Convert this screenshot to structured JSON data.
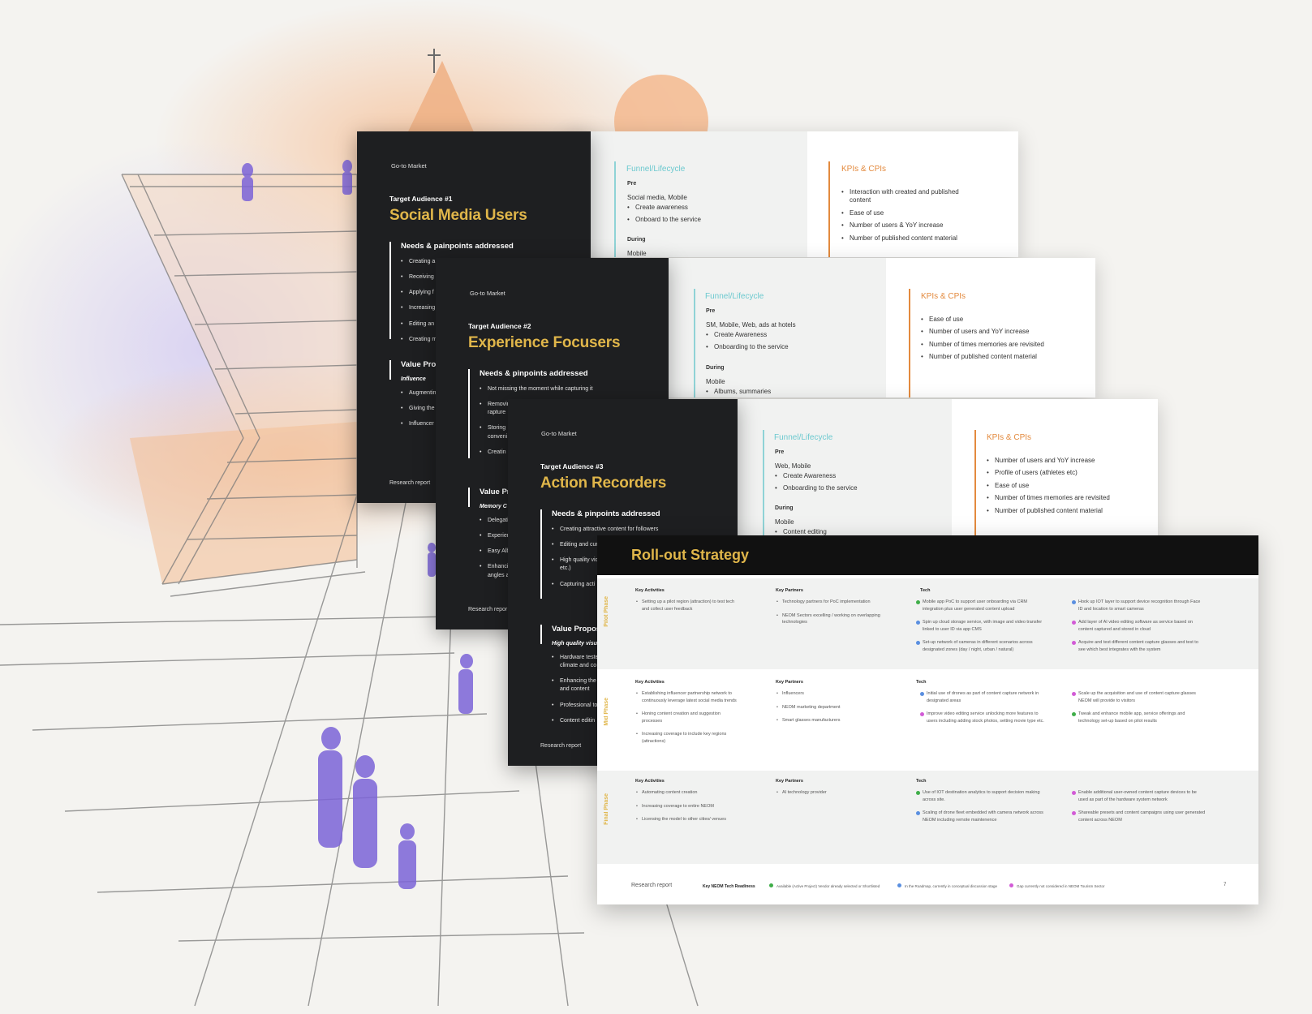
{
  "colors": {
    "gold": "#e0b64a",
    "teal": "#6cc9cf",
    "orange": "#e38a3e",
    "dark": "#1e1f21",
    "green": "#3fae49",
    "blue": "#5a8fe0",
    "pink": "#d25bd6"
  },
  "slide1": {
    "gtm": "Go-to Market",
    "ta_label": "Target Audience #1",
    "ta_title": "Social Media Users",
    "needs_head": "Needs & painpoints addressed",
    "needs": [
      "Creating a",
      "Receiving",
      "Applying f",
      "Increasing",
      "Editing an",
      "Creating m"
    ],
    "value_head": "Value Pro",
    "value_sub": "Influence",
    "value_items": [
      "Augmentin",
      "Giving the",
      "Influencer"
    ],
    "research": "Research report",
    "funnel_title": "Funnel/Lifecycle",
    "pre": "Pre",
    "pre_channels": "Social media, Mobile",
    "pre_items": [
      "Create awareness",
      "Onboard to the service"
    ],
    "during": "During",
    "during_channels": "Mobile",
    "kpi_title": "KPIs & CPIs",
    "kpis": [
      "Interaction with created and published content",
      "Ease of use",
      "Number of users & YoY increase",
      "Number of published content material"
    ]
  },
  "slide2": {
    "gtm": "Go-to Market",
    "ta_label": "Target Audience #2",
    "ta_title": "Experience Focusers",
    "needs_head": "Needs & pinpoints addressed",
    "needs": [
      "Not missing the moment while capturing it",
      "Removin\nrapture",
      "Storing\nconveni",
      "Creatin"
    ],
    "value_head": "Value Pr",
    "value_sub": "Memory C",
    "value_items": [
      "Delegati",
      "Experien",
      "Easy Alb",
      "Enhanci\nangles a"
    ],
    "research": "Research repor",
    "funnel_title": "Funnel/Lifecycle",
    "pre": "Pre",
    "pre_channels": "SM, Mobile, Web, ads at hotels",
    "pre_items": [
      "Create Awareness",
      "Onboarding to the service"
    ],
    "during": "During",
    "during_channels": "Mobile",
    "during_items": [
      "Albums, summaries"
    ],
    "kpi_title": "KPIs & CPIs",
    "kpis": [
      "Ease of use",
      "Number of users and YoY increase",
      "Number of times memories are revisited",
      "Number of published content material"
    ]
  },
  "slide3": {
    "gtm": "Go-to Market",
    "ta_label": "Target Audience #3",
    "ta_title": "Action Recorders",
    "needs_head": "Needs & pinpoints addressed",
    "needs": [
      "Creating attractive content for followers",
      "Editing and cur",
      "High quality vic\netc.)",
      "Capturing acti"
    ],
    "value_head": "Value Propos",
    "value_sub": "High quality visua",
    "value_items": [
      "Hardware teste\nclimate and co",
      "Enhancing the\nand content",
      "Professional to",
      "Content editin"
    ],
    "research": "Research report",
    "funnel_title": "Funnel/Lifecycle",
    "pre": "Pre",
    "pre_channels": "Web, Mobile",
    "pre_items": [
      "Create Awareness",
      "Onboarding to the service"
    ],
    "during": "During",
    "during_channels": "Mobile",
    "during_items": [
      "Content editing"
    ],
    "kpi_title": "KPIs & CPIs",
    "kpis": [
      "Number of users and YoY increase",
      "Profile of users (athletes etc)",
      "Ease of use",
      "Number of times memories are revisited",
      "Number of published content material"
    ]
  },
  "rollout": {
    "title": "Roll-out Strategy",
    "col_activities": "Key Activities",
    "col_partners": "Key Partners",
    "col_tech": "Tech",
    "pilot": {
      "label": "Pilot Phase",
      "activities": [
        "Setting up a pilot region (attraction) to test tech and collect user feedback"
      ],
      "partners": [
        "Technology partners for PoC implementation",
        "NEOM Sectors excelling / working on overlapping technologies"
      ],
      "tech_a": [
        {
          "c": "green",
          "t": "Mobile app PoC to support user onboarding via CRM integration plus user generated content upload"
        },
        {
          "c": "blue",
          "t": "Spin up cloud storage service, with image and video transfer linked to user ID via app CMS"
        },
        {
          "c": "blue",
          "t": "Set-up network of cameras in different scenarios across designated zones (day / night, urban / natural)"
        }
      ],
      "tech_b": [
        {
          "c": "blue",
          "t": "Hook up IOT layer to support device recognition through Face ID and location to smart cameras"
        },
        {
          "c": "pink",
          "t": "Add layer of AI video editing software as service based on content captured and stored in cloud"
        },
        {
          "c": "pink",
          "t": "Acquire and test different content capture glasses and test to see which best integrates with the system"
        }
      ]
    },
    "mid": {
      "label": "Mid Phase",
      "activities": [
        "Establishing influencer partnership network to continuously leverage latest social media trends",
        "Honing content creation and suggestion processes",
        "Increasing coverage to include key regions (attractions)"
      ],
      "partners": [
        "Influencers",
        "NEOM marketing department",
        "Smart glasses manufacturers"
      ],
      "tech_a": [
        {
          "c": "blue",
          "t": "Initial use of drones as part of content capture network in designated areas"
        },
        {
          "c": "pink",
          "t": "Improve video editing service unlocking more features to users including adding stock photos, setting movie type etc."
        }
      ],
      "tech_b": [
        {
          "c": "pink",
          "t": "Scale up the acquisition and use of content capture glasses NEOM will provide to visitors"
        },
        {
          "c": "green",
          "t": "Tweak and enhance mobile app, service offerings and technology set-up based on pilot results"
        }
      ]
    },
    "final": {
      "label": "Final Phase",
      "activities": [
        "Automating content creation",
        "Increasing coverage to entire NEOM",
        "Licensing the model to other cities/ venues"
      ],
      "partners": [
        "AI technology provider"
      ],
      "tech_a": [
        {
          "c": "green",
          "t": "Use of IOT destination analytics to support decision making across site."
        },
        {
          "c": "blue",
          "t": "Scaling of drone fleet embedded with camera network across NEOM including remote maintenence"
        }
      ],
      "tech_b": [
        {
          "c": "pink",
          "t": "Enable additional user-owned content capture devices to be used as part of the hardware system network"
        },
        {
          "c": "pink",
          "t": "Shareable presets and content campaigns using user generated content across NEOM"
        }
      ]
    },
    "footer": {
      "research": "Research report",
      "legend_title": "Key NEOM Tech Readiness",
      "legend": [
        {
          "c": "green",
          "t": "Available (Active Project) Vendor already selected or Shortlisted"
        },
        {
          "c": "blue",
          "t": "In the Roadmap, currently in conceptual discussion stage"
        },
        {
          "c": "pink",
          "t": "Gap currently not considered in NEOM Tourism Sector"
        }
      ],
      "page": "7"
    }
  }
}
